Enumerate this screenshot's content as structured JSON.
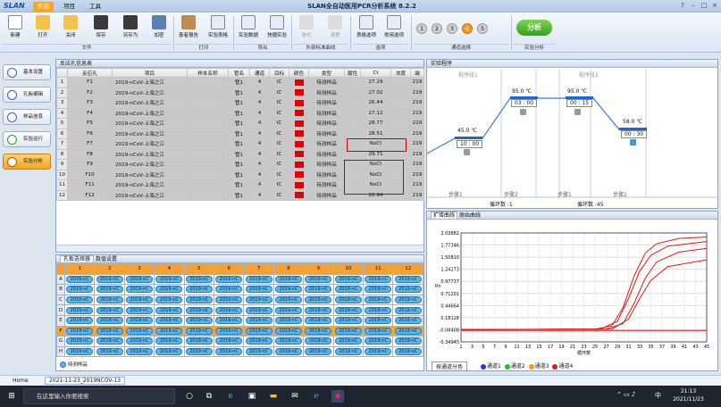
{
  "app": {
    "logo": "SLAN",
    "title": "SLAN全自动医用PCR分析系统 8.2.2",
    "menu": [
      "实验",
      "项目",
      "工具"
    ],
    "win": [
      "?",
      "–",
      "□",
      "×"
    ]
  },
  "ribbon": {
    "buttons": [
      "新建",
      "打开",
      "关闭",
      "保存",
      "另存为",
      "加密",
      "患者报告",
      "实验表格",
      "实验数据",
      "快捷实验",
      "迭代",
      "清楚",
      "表格选项",
      "常用选项"
    ],
    "groups": [
      "文件",
      "打印",
      "导出",
      "外部标准曲线",
      "选项",
      "通道选择",
      "实验分析"
    ],
    "channels": [
      "1",
      "2",
      "3",
      "4",
      "5"
    ],
    "analyze": "分析"
  },
  "nav": [
    "基本设置",
    "孔板编辑",
    "样品信息",
    "实验运行",
    "实验分析"
  ],
  "table": {
    "title": "反应孔信息表",
    "headers": [
      "",
      "反应孔",
      "项目",
      "样本名称",
      "管名",
      "通道",
      "目标",
      "颜色",
      "类型",
      "属性",
      "Ct",
      "浓度",
      "端"
    ],
    "rows": [
      [
        "1",
        "F1",
        "2019-nCoV-上海之江",
        "",
        "管1",
        "4",
        "IC",
        "",
        "待测样品",
        "",
        "27.29",
        "",
        "219"
      ],
      [
        "2",
        "F2",
        "2019-nCoV-上海之江",
        "",
        "管1",
        "4",
        "IC",
        "",
        "待测样品",
        "",
        "27.02",
        "",
        "219"
      ],
      [
        "3",
        "F3",
        "2019-nCoV-上海之江",
        "",
        "管1",
        "4",
        "IC",
        "",
        "待测样品",
        "",
        "26.44",
        "",
        "219"
      ],
      [
        "4",
        "F4",
        "2019-nCoV-上海之江",
        "",
        "管1",
        "4",
        "IC",
        "",
        "待测样品",
        "",
        "27.12",
        "",
        "219"
      ],
      [
        "5",
        "F5",
        "2019-nCoV-上海之江",
        "",
        "管1",
        "4",
        "IC",
        "",
        "待测样品",
        "",
        "28.77",
        "",
        "219"
      ],
      [
        "6",
        "F6",
        "2019-nCoV-上海之江",
        "",
        "管1",
        "4",
        "IC",
        "",
        "待测样品",
        "",
        "28.51",
        "",
        "219"
      ],
      [
        "7",
        "F7",
        "2019-nCoV-上海之江",
        "",
        "管1",
        "4",
        "IC",
        "",
        "待测样品",
        "",
        "NoCt",
        "",
        "219"
      ],
      [
        "8",
        "F8",
        "2019-nCoV-上海之江",
        "",
        "管1",
        "4",
        "IC",
        "",
        "待测样品",
        "",
        "29.71",
        "",
        "219"
      ],
      [
        "9",
        "F9",
        "2019-nCoV-上海之江",
        "",
        "管1",
        "4",
        "IC",
        "",
        "待测样品",
        "",
        "NoCt",
        "",
        "219"
      ],
      [
        "10",
        "F10",
        "2019-nCoV-上海之江",
        "",
        "管1",
        "4",
        "IC",
        "",
        "待测样品",
        "",
        "NoCt",
        "",
        "219"
      ],
      [
        "11",
        "F11",
        "2019-nCoV-上海之江",
        "",
        "管1",
        "4",
        "IC",
        "",
        "待测样品",
        "",
        "NoCt",
        "",
        "219"
      ],
      [
        "12",
        "F12",
        "2019-nCoV-上海之江",
        "",
        "管1",
        "4",
        "IC",
        "",
        "待测样品",
        "",
        "28.94",
        "",
        "219"
      ]
    ]
  },
  "plate": {
    "tabs": [
      "孔板选择器",
      "数值设置"
    ],
    "cols": [
      "1",
      "2",
      "3",
      "4",
      "5",
      "6",
      "7",
      "8",
      "9",
      "10",
      "11",
      "12"
    ],
    "rows": [
      "A",
      "B",
      "C",
      "D",
      "E",
      "F",
      "G",
      "H"
    ],
    "well_label": "2019-nC",
    "selected_row": "F",
    "legend": "待测样品"
  },
  "program": {
    "title": "实验程序",
    "stages": [
      "程序段1",
      "程序段2"
    ],
    "temps": [
      "45.0 ℃",
      "95.0 ℃",
      "95.0 ℃",
      "58.0 ℃"
    ],
    "times": [
      "10 : 00",
      "03 : 00",
      "00 : 15",
      "00 : 30"
    ],
    "steps": [
      "步骤1",
      "步骤2",
      "步骤1",
      "步骤2"
    ],
    "cycles": [
      "循环数 :1",
      "循环数 :45"
    ]
  },
  "amp": {
    "tabs": [
      "扩增曲线",
      "原始曲线"
    ],
    "ylabel": "Rn",
    "xlabel": "循环数",
    "yticks": [
      "2.03882",
      "1.77346",
      "1.50810",
      "1.24273",
      "0.97737",
      "0.71201",
      "0.44664",
      "0.18128",
      "-0.08408",
      "-0.34945"
    ],
    "xticks": [
      "1",
      "3",
      "5",
      "7",
      "9",
      "11",
      "13",
      "15",
      "17",
      "19",
      "21",
      "23",
      "25",
      "27",
      "29",
      "31",
      "33",
      "35",
      "37",
      "39",
      "41",
      "43",
      "45"
    ],
    "mode": "按通道分色",
    "channels": [
      "通道1",
      "通道2",
      "通道3",
      "通道4"
    ],
    "chcolors": [
      "#1f3fd6",
      "#23c01f",
      "#f09a1a",
      "#e01818"
    ]
  },
  "chart_data": {
    "type": "line",
    "title": "扩增曲线",
    "xlabel": "循环数",
    "ylabel": "Rn",
    "xlim": [
      1,
      45
    ],
    "ylim": [
      -0.34945,
      2.03882
    ],
    "series": [
      {
        "name": "通道4",
        "points": [
          [
            1,
            -0.08
          ],
          [
            25,
            -0.07
          ],
          [
            28,
            0.0
          ],
          [
            30,
            0.4
          ],
          [
            32,
            1.1
          ],
          [
            34,
            1.6
          ],
          [
            36,
            1.8
          ],
          [
            40,
            1.92
          ],
          [
            45,
            1.95
          ]
        ]
      },
      {
        "name": "通道4",
        "points": [
          [
            1,
            -0.08
          ],
          [
            26,
            -0.07
          ],
          [
            29,
            0.1
          ],
          [
            31,
            0.6
          ],
          [
            33,
            1.2
          ],
          [
            35,
            1.55
          ],
          [
            38,
            1.75
          ],
          [
            45,
            1.85
          ]
        ]
      },
      {
        "name": "通道4",
        "points": [
          [
            1,
            -0.08
          ],
          [
            27,
            -0.07
          ],
          [
            30,
            0.05
          ],
          [
            32,
            0.5
          ],
          [
            34,
            1.05
          ],
          [
            36,
            1.4
          ],
          [
            40,
            1.62
          ],
          [
            45,
            1.7
          ]
        ]
      },
      {
        "name": "通道4",
        "points": [
          [
            1,
            -0.08
          ],
          [
            28,
            -0.07
          ],
          [
            31,
            0.15
          ],
          [
            33,
            0.6
          ],
          [
            35,
            1.0
          ],
          [
            38,
            1.3
          ],
          [
            45,
            1.45
          ]
        ]
      }
    ]
  },
  "status": {
    "tabs": [
      "Home",
      "2021-11-23_2019NCOV-13"
    ]
  },
  "taskbar": {
    "search": "在这里输入你要搜索",
    "ime": "中",
    "time": "21:13",
    "date": "2021/11/23"
  }
}
